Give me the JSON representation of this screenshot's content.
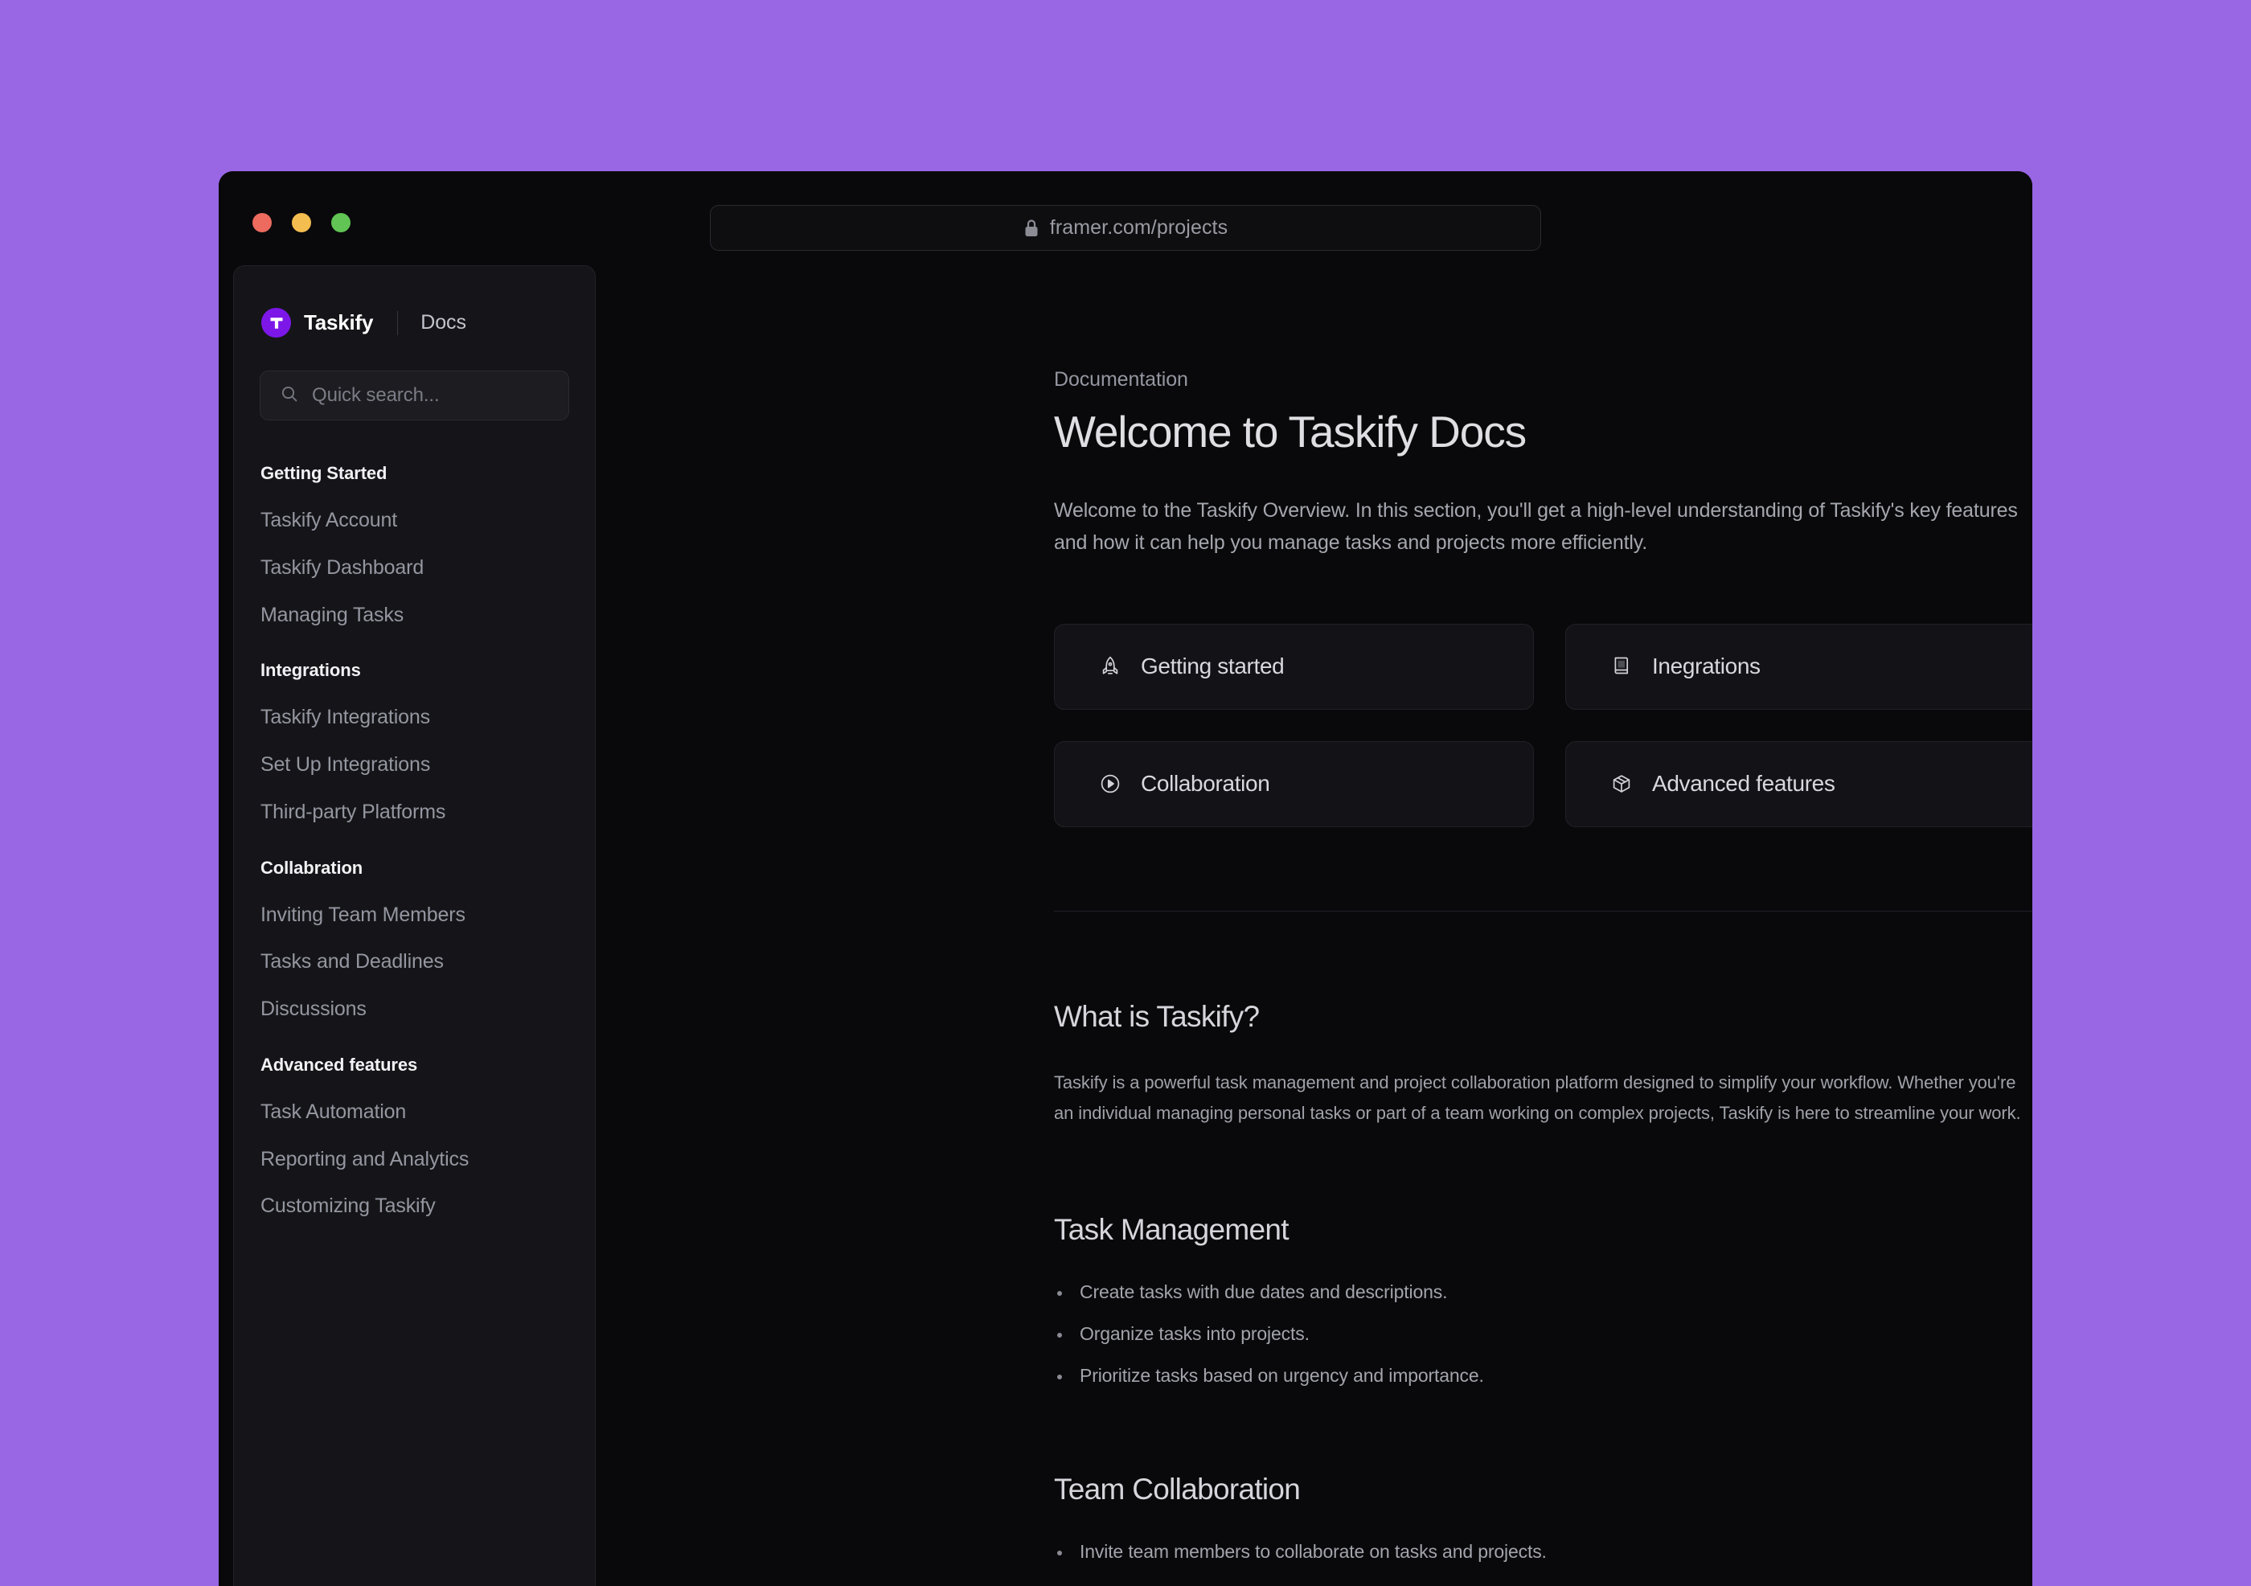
{
  "theme": {
    "page_background": "#9966E4",
    "window_background": "#09090B",
    "sidebar_background": "#151519",
    "card_background": "#131317",
    "brand_purple": "#7C17E8",
    "traffic_red": "#EC6A5E",
    "traffic_yellow": "#F4BD4F",
    "traffic_green": "#61C454"
  },
  "browser": {
    "url": "framer.com/projects",
    "lock_icon": "lock-icon",
    "traffic_lights": [
      "close-button",
      "minimize-button",
      "maximize-button"
    ]
  },
  "sidebar": {
    "brand_name": "Taskify",
    "brand_logo": "taskify-logo-icon",
    "docs_label": "Docs",
    "search": {
      "placeholder": "Quick search...",
      "value": "",
      "icon": "search-icon"
    },
    "groups": [
      {
        "heading": "Getting Started",
        "items": [
          "Taskify Account",
          "Taskify Dashboard",
          "Managing Tasks"
        ]
      },
      {
        "heading": "Integrations",
        "items": [
          "Taskify Integrations",
          "Set Up Integrations",
          "Third-party Platforms"
        ]
      },
      {
        "heading": "Collabration",
        "items": [
          "Inviting Team Members",
          "Tasks and Deadlines",
          "Discussions"
        ]
      },
      {
        "heading": "Advanced features",
        "items": [
          "Task Automation",
          "Reporting and Analytics",
          "Customizing Taskify"
        ]
      }
    ]
  },
  "main": {
    "eyebrow": "Documentation",
    "title": "Welcome to Taskify Docs",
    "lede": "Welcome to the Taskify Overview. In this section, you'll get a high-level understanding of Taskify's key features and how it can help you manage tasks and projects more efficiently.",
    "cards": [
      {
        "label": "Getting started",
        "icon": "rocket-icon"
      },
      {
        "label": "Inegrations",
        "icon": "book-icon"
      },
      {
        "label": "Collaboration",
        "icon": "play-circle-icon"
      },
      {
        "label": "Advanced features",
        "icon": "box-icon"
      }
    ],
    "sections": [
      {
        "title": "What is Taskify?",
        "paragraph": "Taskify is a powerful task management and project collaboration platform designed to simplify your workflow. Whether you're an individual managing personal tasks or part of a team working on complex projects, Taskify is here to streamline your work."
      },
      {
        "title": "Task Management",
        "bullets": [
          "Create tasks with due dates and descriptions.",
          "Organize tasks into projects.",
          "Prioritize tasks based on urgency and importance."
        ]
      },
      {
        "title": "Team Collaboration",
        "bullets": [
          "Invite team members to collaborate on tasks and projects."
        ]
      }
    ]
  }
}
